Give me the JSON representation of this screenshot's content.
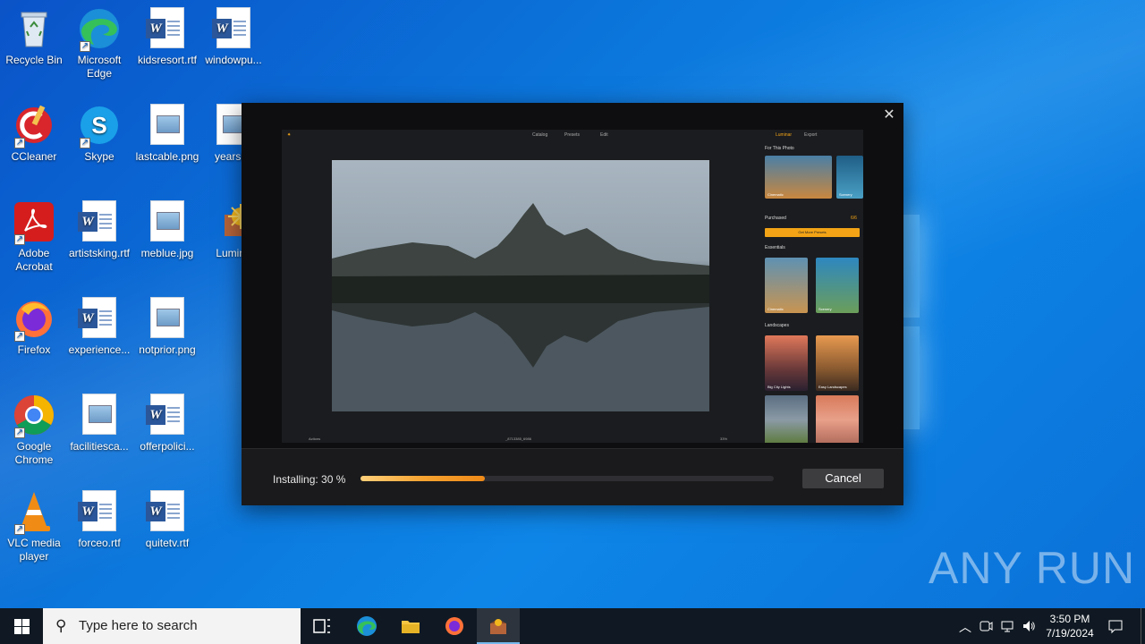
{
  "desktop": {
    "icons": [
      {
        "label": "Recycle Bin"
      },
      {
        "label": "Microsoft Edge"
      },
      {
        "label": "kidsresort.rtf"
      },
      {
        "label": "windowpu..."
      },
      {
        "label": "CCleaner"
      },
      {
        "label": "Skype"
      },
      {
        "label": "lastcable.png"
      },
      {
        "label": "yearskb"
      },
      {
        "label": "Adobe Acrobat"
      },
      {
        "label": "artistsking.rtf"
      },
      {
        "label": "meblue.jpg"
      },
      {
        "label": "Lumina"
      },
      {
        "label": "Firefox"
      },
      {
        "label": "experience..."
      },
      {
        "label": "notprior.png"
      },
      {
        "label": "Google Chrome"
      },
      {
        "label": "facilitiesca..."
      },
      {
        "label": "offerpolici..."
      },
      {
        "label": "VLC media player"
      },
      {
        "label": "forceo.rtf"
      },
      {
        "label": "quitetv.rtf"
      }
    ]
  },
  "installer": {
    "close_glyph": "✕",
    "preview": {
      "tabs": [
        "Catalog",
        "Presets",
        "Edit"
      ],
      "top_right": [
        "Luminar",
        "Export"
      ],
      "side": {
        "for_this_photo": "For This Photo",
        "thumb1": "Cinematic",
        "thumb2": "Scenery",
        "purchased": "Purchased",
        "purchased_count": "6/6",
        "get_more": "Get More Presets",
        "essentials": "Essentials",
        "ess1": "Cinematic",
        "ess2": "Scenery",
        "landscapes": "Landscapes",
        "land1": "Big City Lights",
        "land2": "Easy Landscapes"
      },
      "bottom_left": "Actions",
      "bottom_center": "_8713385_6986",
      "bottom_right": "33%"
    },
    "status_text": "Installing: 30 %",
    "progress_percent": 30,
    "cancel_label": "Cancel"
  },
  "watermark": "ANY RUN",
  "taskbar": {
    "search_placeholder": "Type here to search",
    "time": "3:50 PM",
    "date": "7/19/2024"
  },
  "colors": {
    "accent": "#ef8a18",
    "taskbar": "#101923",
    "desktop": "#0b74da"
  }
}
